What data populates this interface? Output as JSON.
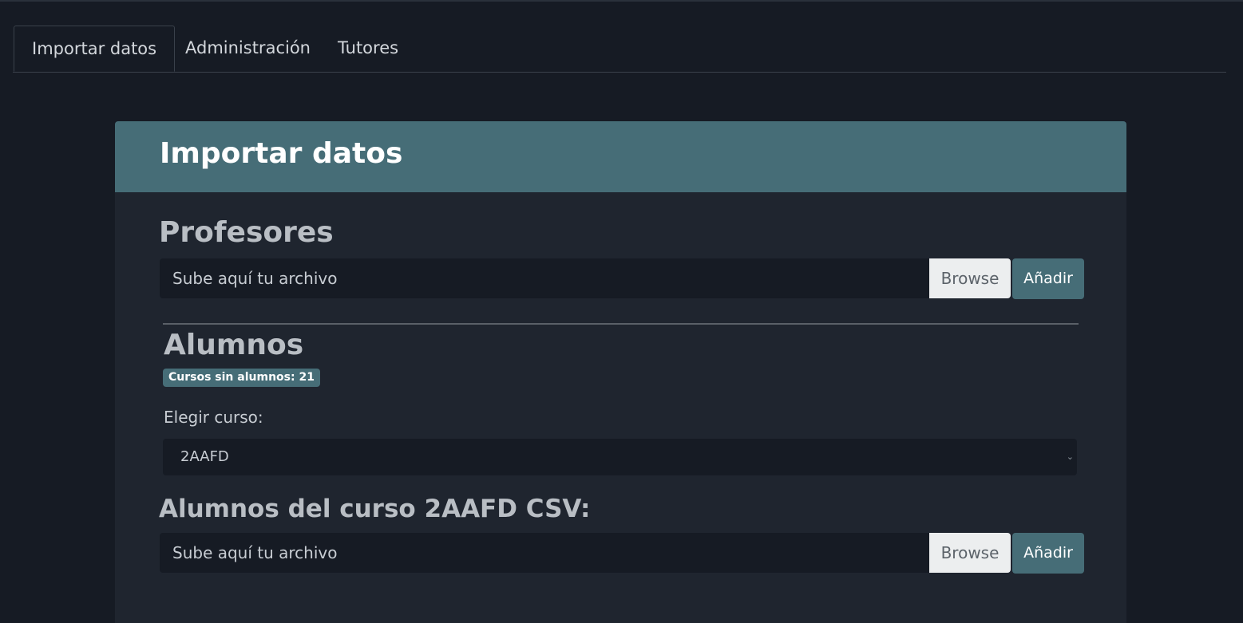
{
  "tabs": [
    {
      "label": "Importar datos",
      "active": true
    },
    {
      "label": "Administración",
      "active": false
    },
    {
      "label": "Tutores",
      "active": false
    }
  ],
  "card": {
    "title": "Importar datos"
  },
  "profesores": {
    "heading": "Profesores",
    "file_placeholder": "Sube aquí tu archivo",
    "browse_label": "Browse",
    "add_label": "Añadir"
  },
  "alumnos": {
    "heading": "Alumnos",
    "badge": "Cursos sin alumnos: 21",
    "select_label": "Elegir curso:",
    "selected_course": "2AAFD",
    "csv_heading": "Alumnos del curso 2AAFD CSV:",
    "file_placeholder": "Sube aquí tu archivo",
    "browse_label": "Browse",
    "add_label": "Añadir"
  },
  "colors": {
    "background": "#161b24",
    "card": "#1f252f",
    "accent": "#466d77"
  },
  "icons": {
    "select_chevron": "chevron-down-icon"
  }
}
